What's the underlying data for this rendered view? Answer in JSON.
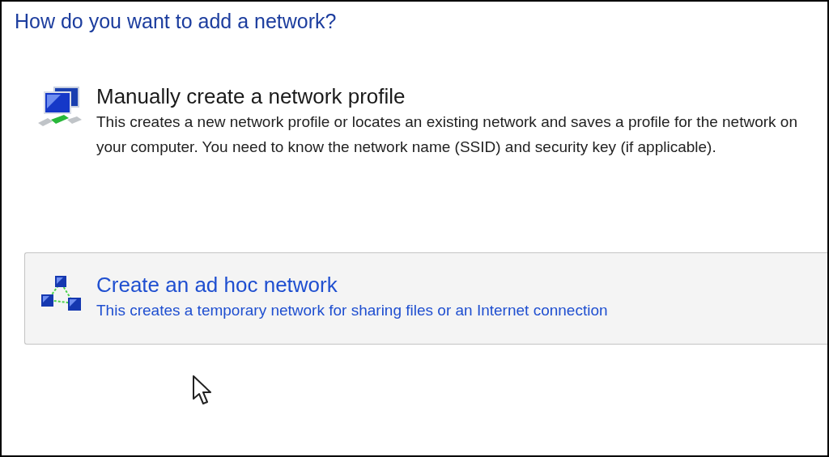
{
  "heading": "How do you want to add a network?",
  "options": [
    {
      "kind": "manual",
      "title": "Manually create a network profile",
      "description": "This creates a new network profile or locates an existing network and saves a profile for the network on your computer. You need to know the network name (SSID) and security key (if applicable).",
      "highlighted": false
    },
    {
      "kind": "adhoc",
      "title": "Create an ad hoc network",
      "description": "This creates a temporary network for sharing files or an Internet connection",
      "highlighted": true
    }
  ]
}
